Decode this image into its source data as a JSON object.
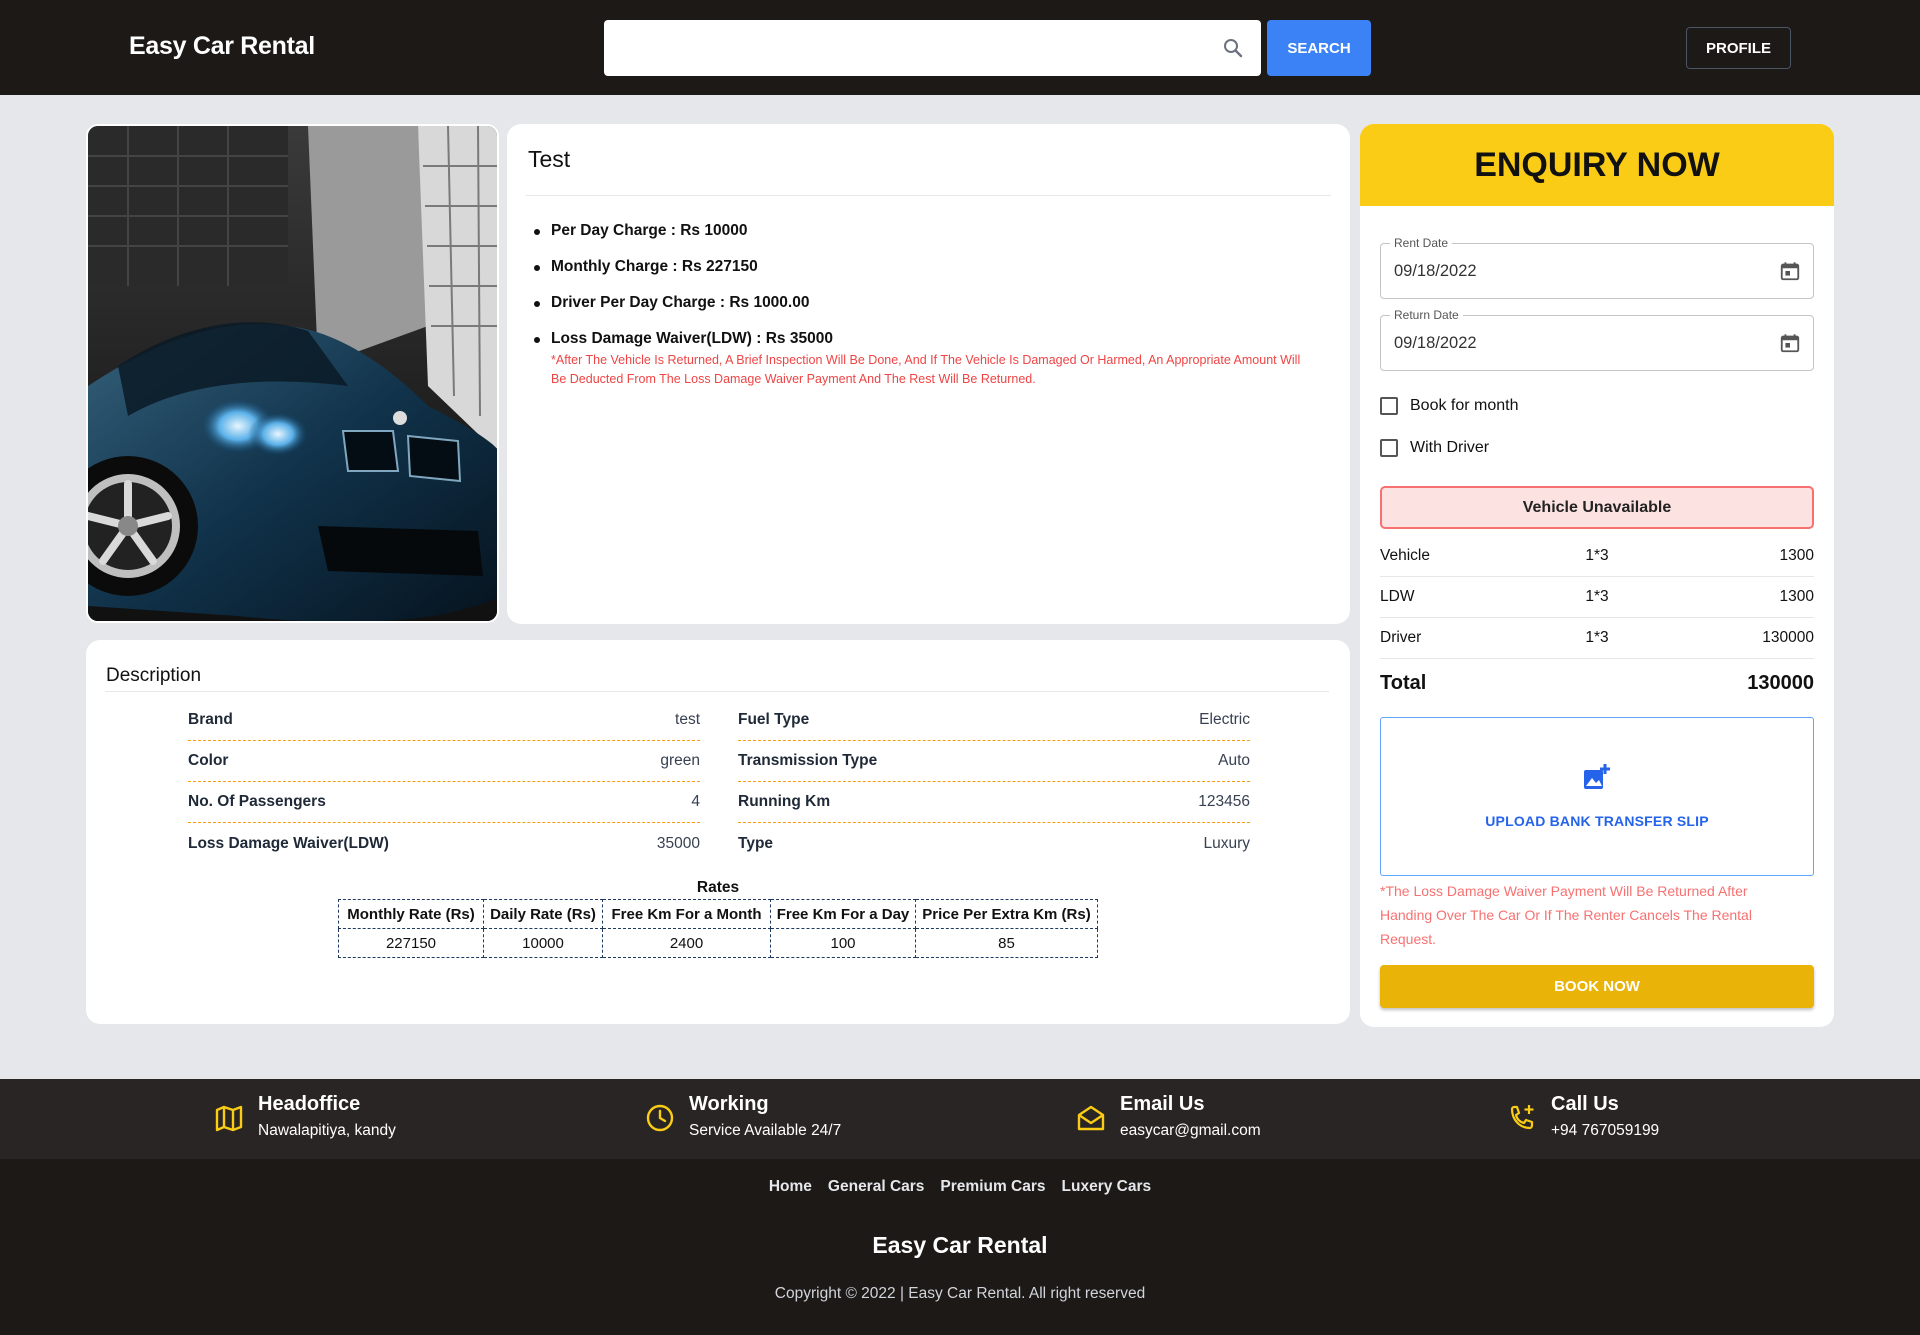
{
  "header": {
    "brand": "Easy Car Rental",
    "search_placeholder": "",
    "search_button": "SEARCH",
    "profile_button": "PROFILE"
  },
  "car": {
    "title": "Test",
    "image_icon": "car-photo",
    "charges": [
      "Per Day Charge : Rs 10000",
      "Monthly Charge : Rs 227150",
      "Driver Per Day Charge : Rs 1000.00",
      "Loss Damage Waiver(LDW) : Rs 35000"
    ],
    "ldw_note": "*After The Vehicle Is Returned, A Brief Inspection Will Be Done, And If The Vehicle Is Damaged Or Harmed, An Appropriate Amount Will Be Deducted From The Loss Damage Waiver Payment And The Rest Will Be Returned."
  },
  "description": {
    "title": "Description",
    "left_specs": [
      {
        "label": "Brand",
        "value": "test"
      },
      {
        "label": "Color",
        "value": "green"
      },
      {
        "label": "No. Of Passengers",
        "value": "4"
      },
      {
        "label": "Loss Damage Waiver(LDW)",
        "value": "35000"
      }
    ],
    "right_specs": [
      {
        "label": "Fuel Type",
        "value": "Electric"
      },
      {
        "label": "Transmission Type",
        "value": "Auto"
      },
      {
        "label": "Running Km",
        "value": "123456"
      },
      {
        "label": "Type",
        "value": "Luxury"
      }
    ],
    "rates_caption": "Rates",
    "rates_headers": [
      "Monthly Rate (Rs)",
      "Daily Rate (Rs)",
      "Free Km For a Month",
      "Free Km For a Day",
      "Price Per Extra Km (Rs)"
    ],
    "rates_values": [
      "227150",
      "10000",
      "2400",
      "100",
      "85"
    ]
  },
  "enquiry": {
    "title": "ENQUIRY NOW",
    "rent_date_label": "Rent Date",
    "rent_date_value": "09/18/2022",
    "return_date_label": "Return Date",
    "return_date_value": "09/18/2022",
    "book_for_month": "Book for month",
    "with_driver": "With Driver",
    "status": "Vehicle Unavailable",
    "price_rows": [
      {
        "item": "Vehicle",
        "qty": "1*3",
        "amount": "1300"
      },
      {
        "item": "LDW",
        "qty": "1*3",
        "amount": "1300"
      },
      {
        "item": "Driver",
        "qty": "1*3",
        "amount": "130000"
      }
    ],
    "total_label": "Total",
    "total_value": "130000",
    "upload_label": "UPLOAD BANK TRANSFER SLIP",
    "refund_note": "*The Loss Damage Waiver Payment Will Be Returned After Handing Over The Car Or If The Renter Cancels The Rental Request.",
    "book_button": "BOOK NOW"
  },
  "footer": {
    "contacts": [
      {
        "icon": "map-icon",
        "title": "Headoffice",
        "sub": "Nawalapitiya, kandy"
      },
      {
        "icon": "clock-icon",
        "title": "Working",
        "sub": "Service Available 24/7"
      },
      {
        "icon": "mail-icon",
        "title": "Email Us",
        "sub": "easycar@gmail.com"
      },
      {
        "icon": "phone-add-icon",
        "title": "Call Us",
        "sub": "+94 767059199"
      }
    ],
    "nav": [
      "Home",
      "General Cars",
      "Premium Cars",
      "Luxery Cars"
    ],
    "brand": "Easy Car Rental",
    "copyright": "Copyright © 2022 | Easy Car Rental. All right reserved"
  },
  "colors": {
    "header_bg": "#1c1917",
    "accent_yellow": "#facc15",
    "book_button": "#eab308",
    "search_button": "#3b82f6",
    "warning_red": "#ef4444",
    "footer_icon": "#facc15"
  }
}
